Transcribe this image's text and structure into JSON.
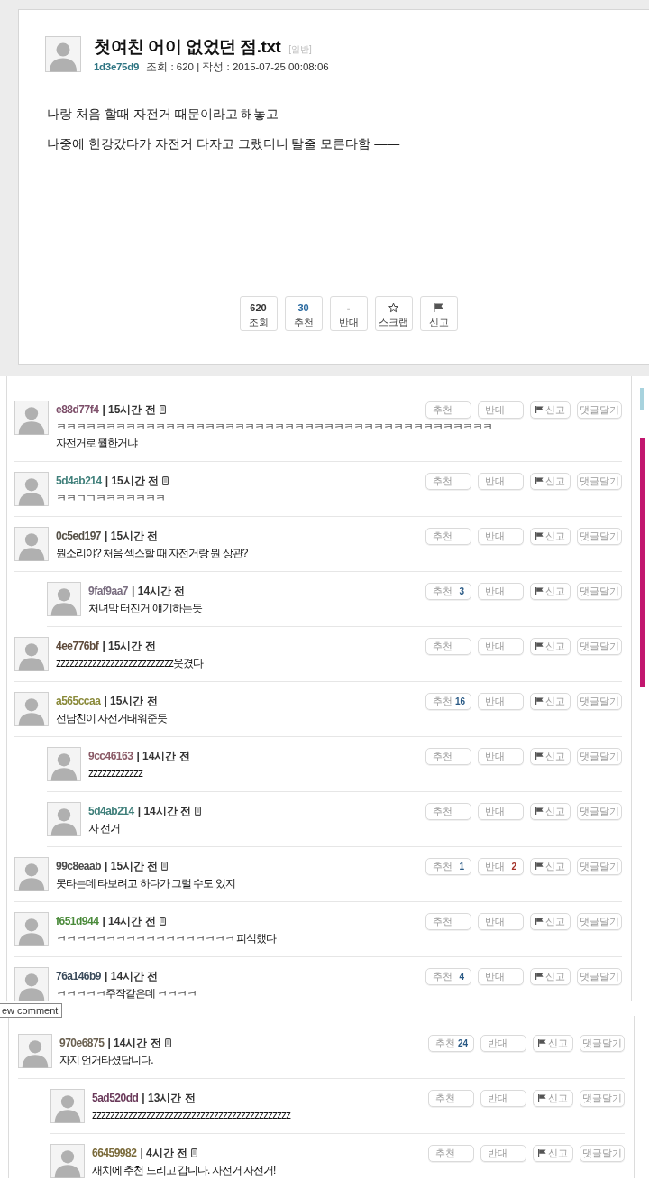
{
  "post": {
    "title": "첫여친 어이 없었던 점.txt",
    "category": "[일반]",
    "author": "1d3e75d9",
    "meta": "| 조회 : 620 | 작성 : 2015-07-25 00:08:06",
    "body": [
      "나랑 처음 할때 자전거 때문이라고 해놓고",
      "나중에 한강갔다가 자전거 타자고 그랬더니 탈줄 모른다함 ——"
    ],
    "buttons": [
      {
        "kind": "views",
        "value": "620",
        "label": "조회"
      },
      {
        "kind": "up",
        "value": "30",
        "label": "추천"
      },
      {
        "kind": "down",
        "value": "-",
        "label": "반대"
      },
      {
        "kind": "scrap",
        "label": "스크랩"
      },
      {
        "kind": "report",
        "label": "신고"
      }
    ]
  },
  "comments": [
    {
      "author": "e88d77f4",
      "color": "#7d4f6a",
      "time": "| 15시간 전",
      "mobile": true,
      "lines": [
        "ㅋㅋㅋㅋㅋㅋㅋㅋㅋㅋㅋㅋㅋㅋㅋㅋㅋㅋㅋㅋㅋㅋㅋㅋㅋㅋㅋㅋㅋㅋㅋㅋㅋㅋㅋㅋㅋㅋㅋㅋㅋㅋㅋㅋ",
        "자전거로 뭘한거냐"
      ],
      "buttons": [
        {
          "kind": "up",
          "label": "추천"
        },
        {
          "kind": "down",
          "label": "반대"
        },
        {
          "kind": "report",
          "label": "신고"
        },
        {
          "kind": "reply",
          "label": "댓글달기"
        }
      ]
    },
    {
      "author": "5d4ab214",
      "color": "#3f7f7a",
      "time": "| 15시간 전",
      "mobile": true,
      "lines": [
        "ㅋㅋㄱㄱㅋㅋㅋㅋㅋㅋㅋ"
      ],
      "buttons": [
        {
          "kind": "up",
          "label": "추천"
        },
        {
          "kind": "down",
          "label": "반대"
        },
        {
          "kind": "report",
          "label": "신고"
        },
        {
          "kind": "reply",
          "label": "댓글달기"
        }
      ]
    },
    {
      "author": "0c5ed197",
      "color": "#555046",
      "time": "| 15시간 전",
      "mobile": false,
      "lines": [
        "뭔소리야? 처음 섹스할 때 자전거랑 뭔 상관?"
      ],
      "buttons": [
        {
          "kind": "up",
          "label": "추천"
        },
        {
          "kind": "down",
          "label": "반대"
        },
        {
          "kind": "report",
          "label": "신고"
        },
        {
          "kind": "reply",
          "label": "댓글달기"
        }
      ],
      "children": [
        {
          "author": "9faf9aa7",
          "color": "#7a6e80",
          "time": "| 14시간 전",
          "mobile": false,
          "lines": [
            "처녀막 터진거 얘기하는듯"
          ],
          "buttons": [
            {
              "kind": "up",
              "label": "추천",
              "count": "3"
            },
            {
              "kind": "down",
              "label": "반대"
            },
            {
              "kind": "report",
              "label": "신고"
            },
            {
              "kind": "reply",
              "label": "댓글달기"
            }
          ]
        }
      ]
    },
    {
      "author": "4ee776bf",
      "color": "#5e4a3a",
      "time": "| 15시간 전",
      "mobile": false,
      "lines": [
        "zzzzzzzzzzzzzzzzzzzzzzzzzz웃겼다"
      ],
      "buttons": [
        {
          "kind": "up",
          "label": "추천"
        },
        {
          "kind": "down",
          "label": "반대"
        },
        {
          "kind": "report",
          "label": "신고"
        },
        {
          "kind": "reply",
          "label": "댓글달기"
        }
      ]
    },
    {
      "author": "a565ccaa",
      "color": "#8a8a3a",
      "time": "| 15시간 전",
      "mobile": false,
      "lines": [
        "전남친이 자전거태워준듯"
      ],
      "buttons": [
        {
          "kind": "up",
          "label": "추천",
          "count": "16"
        },
        {
          "kind": "down",
          "label": "반대"
        },
        {
          "kind": "report",
          "label": "신고"
        },
        {
          "kind": "reply",
          "label": "댓글달기"
        }
      ],
      "children": [
        {
          "author": "9cc46163",
          "color": "#8a5a66",
          "time": "| 14시간 전",
          "mobile": false,
          "lines": [
            "zzzzzzzzzzzz"
          ],
          "buttons": [
            {
              "kind": "up",
              "label": "추천"
            },
            {
              "kind": "down",
              "label": "반대"
            },
            {
              "kind": "report",
              "label": "신고"
            },
            {
              "kind": "reply",
              "label": "댓글달기"
            }
          ]
        },
        {
          "author": "5d4ab214",
          "color": "#3f7f7a",
          "time": "| 14시간 전",
          "mobile": true,
          "lines": [
            "자 전거"
          ],
          "buttons": [
            {
              "kind": "up",
              "label": "추천"
            },
            {
              "kind": "down",
              "label": "반대"
            },
            {
              "kind": "report",
              "label": "신고"
            },
            {
              "kind": "reply",
              "label": "댓글달기"
            }
          ]
        }
      ]
    },
    {
      "author": "99c8eaab",
      "color": "#4a4a4a",
      "time": "| 15시간 전",
      "mobile": true,
      "lines": [
        "못타는데 타보려고 하다가 그럴 수도 있지"
      ],
      "buttons": [
        {
          "kind": "up",
          "label": "추천",
          "count": "1"
        },
        {
          "kind": "down",
          "label": "반대",
          "count": "2"
        },
        {
          "kind": "report",
          "label": "신고"
        },
        {
          "kind": "reply",
          "label": "댓글달기"
        }
      ]
    },
    {
      "author": "f651d944",
      "color": "#4a8a3a",
      "time": "| 14시간 전",
      "mobile": true,
      "lines": [
        "ㅋㅋㅋㅋㅋㅋㅋㅋㅋㅋㅋㅋㅋㅋㅋㅋㅋㅋ 피식했다"
      ],
      "buttons": [
        {
          "kind": "up",
          "label": "추천"
        },
        {
          "kind": "down",
          "label": "반대"
        },
        {
          "kind": "report",
          "label": "신고"
        },
        {
          "kind": "reply",
          "label": "댓글달기"
        }
      ]
    },
    {
      "author": "76a146b9",
      "color": "#3a4a5a",
      "time": "| 14시간 전",
      "mobile": false,
      "lines": [
        "ㅋㅋㅋㅋㅋ주작같은데 ㅋㅋㅋㅋ"
      ],
      "buttons": [
        {
          "kind": "up",
          "label": "추천",
          "count": "4"
        },
        {
          "kind": "down",
          "label": "반대"
        },
        {
          "kind": "report",
          "label": "신고"
        },
        {
          "kind": "reply",
          "label": "댓글달기"
        }
      ]
    }
  ],
  "tooltip": "ew comment",
  "comments_continued": [
    {
      "author": "970e6875",
      "color": "#6a6050",
      "time": "| 14시간 전",
      "mobile": true,
      "lines": [
        "자지 언거타셨답니다."
      ],
      "buttons": [
        {
          "kind": "up",
          "label": "추천",
          "count": "24"
        },
        {
          "kind": "down",
          "label": "반대"
        },
        {
          "kind": "report",
          "label": "신고"
        },
        {
          "kind": "reply",
          "label": "댓글달기"
        }
      ],
      "children": [
        {
          "author": "5ad520dd",
          "color": "#6a3a5a",
          "time": "| 13시간 전",
          "mobile": false,
          "lines": [
            "zzzzzzzzzzzzzzzzzzzzzzzzzzzzzzzzzzzzzzzzzzzz"
          ],
          "buttons": [
            {
              "kind": "up",
              "label": "추천"
            },
            {
              "kind": "down",
              "label": "반대"
            },
            {
              "kind": "report",
              "label": "신고"
            },
            {
              "kind": "reply",
              "label": "댓글달기"
            }
          ]
        },
        {
          "author": "66459982",
          "color": "#7a6a3a",
          "time": "| 4시간 전",
          "mobile": true,
          "lines": [
            "재치에 추천 드리고 갑니다. 자전거 자전거!"
          ],
          "buttons": [
            {
              "kind": "up",
              "label": "추천"
            },
            {
              "kind": "down",
              "label": "반대"
            },
            {
              "kind": "report",
              "label": "신고"
            },
            {
              "kind": "reply",
              "label": "댓글달기"
            }
          ]
        }
      ]
    }
  ]
}
